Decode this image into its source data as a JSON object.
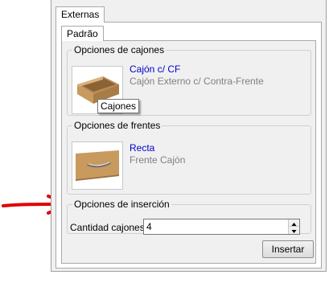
{
  "tabs": {
    "outer": "Externas",
    "inner": "Padrão"
  },
  "drawers_group": {
    "legend": "Opciones de cajones",
    "item_title": "Cajón c/ CF",
    "item_subtitle": "Cajón Externo c/ Contra-Frente",
    "tooltip": "Cajones"
  },
  "fronts_group": {
    "legend": "Opciones de frentes",
    "item_title": "Recta",
    "item_subtitle": "Frente Cajón"
  },
  "insertion_group": {
    "legend": "Opciones de inserción",
    "quantity_label": "Cantidad cajones:",
    "quantity_value": "4"
  },
  "actions": {
    "insert_label": "Insertar"
  },
  "colors": {
    "link": "#0000cc",
    "subtitle": "#808080",
    "annotation_arrow": "#e00000",
    "wood": "#c89a5e"
  },
  "icons": {
    "drawer_thumbnail": "drawer-box-icon",
    "front_thumbnail": "drawer-front-icon",
    "annotation": "red-arrow-icon"
  }
}
